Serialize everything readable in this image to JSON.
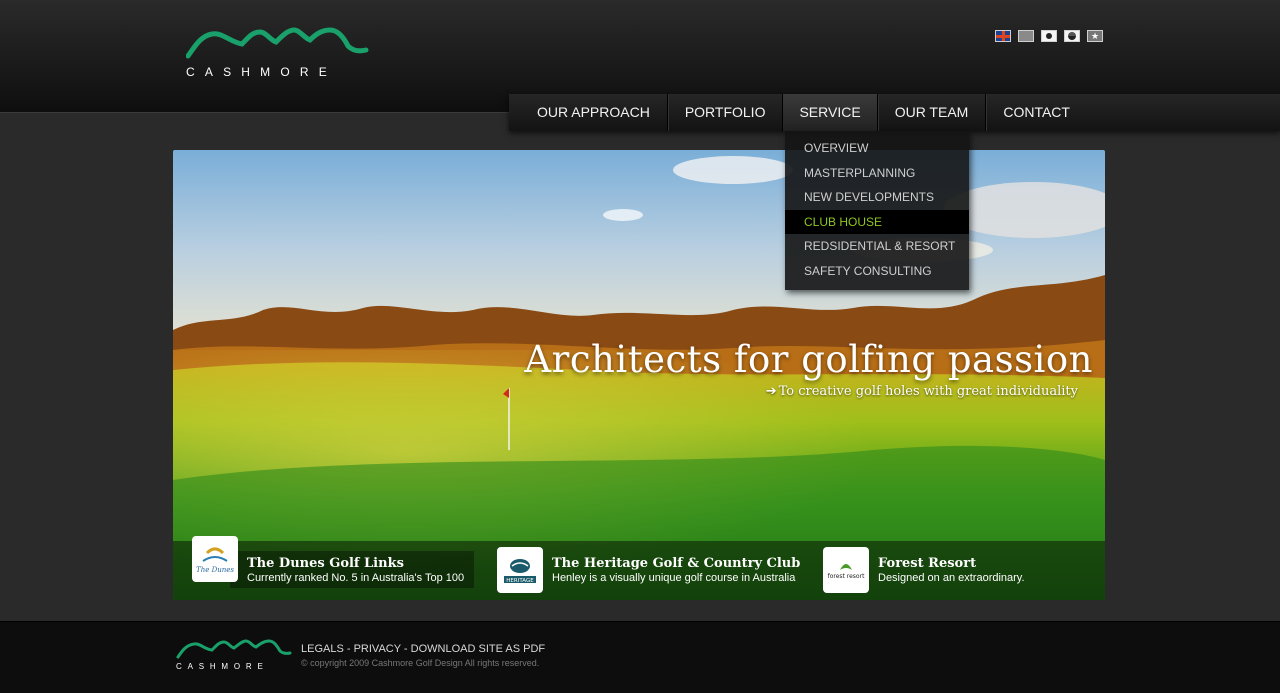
{
  "brand": {
    "name": "CASHMORE",
    "accent_color": "#1aa06a"
  },
  "languages": [
    {
      "name": "uk-flag-icon"
    },
    {
      "name": "china-flag-icon"
    },
    {
      "name": "japan-flag-icon"
    },
    {
      "name": "korea-flag-icon"
    },
    {
      "name": "vietnam-flag-icon",
      "glyph": "★"
    }
  ],
  "nav": {
    "items": [
      "OUR APPROACH",
      "PORTFOLIO",
      "SERVICE",
      "OUR TEAM",
      "CONTACT"
    ],
    "active": "SERVICE"
  },
  "service_menu": {
    "items": [
      "OVERVIEW",
      "MASTERPLANNING",
      "NEW DEVELOPMENTS",
      "CLUB HOUSE",
      "REDSIDENTIAL & RESORT",
      "SAFETY CONSULTING"
    ],
    "active": "CLUB HOUSE",
    "highlight_color": "#8fc61e"
  },
  "hero": {
    "headline": "Architects for golfing passion",
    "subline": "To creative golf holes with great individuality",
    "arrow_glyph": "➔"
  },
  "courses": [
    {
      "title": "The Dunes Golf Links",
      "desc": "Currently ranked No. 5 in Australia's Top 100",
      "logo_text": "The Dunes"
    },
    {
      "title": "The Heritage Golf & Country Club",
      "desc": "Henley is a visually unique golf course in Australia",
      "logo_text": "HERITAGE"
    },
    {
      "title": "Forest Resort",
      "desc": "Designed on an extraordinary.",
      "logo_text": "forest resort"
    }
  ],
  "footer": {
    "brand": "CASHMORE",
    "links": [
      "LEGALS",
      "PRIVACY",
      "DOWNLOAD SITE AS PDF"
    ],
    "separator": " - ",
    "copyright": "© copyright 2009 Cashmore Golf Design All rights reserved."
  }
}
